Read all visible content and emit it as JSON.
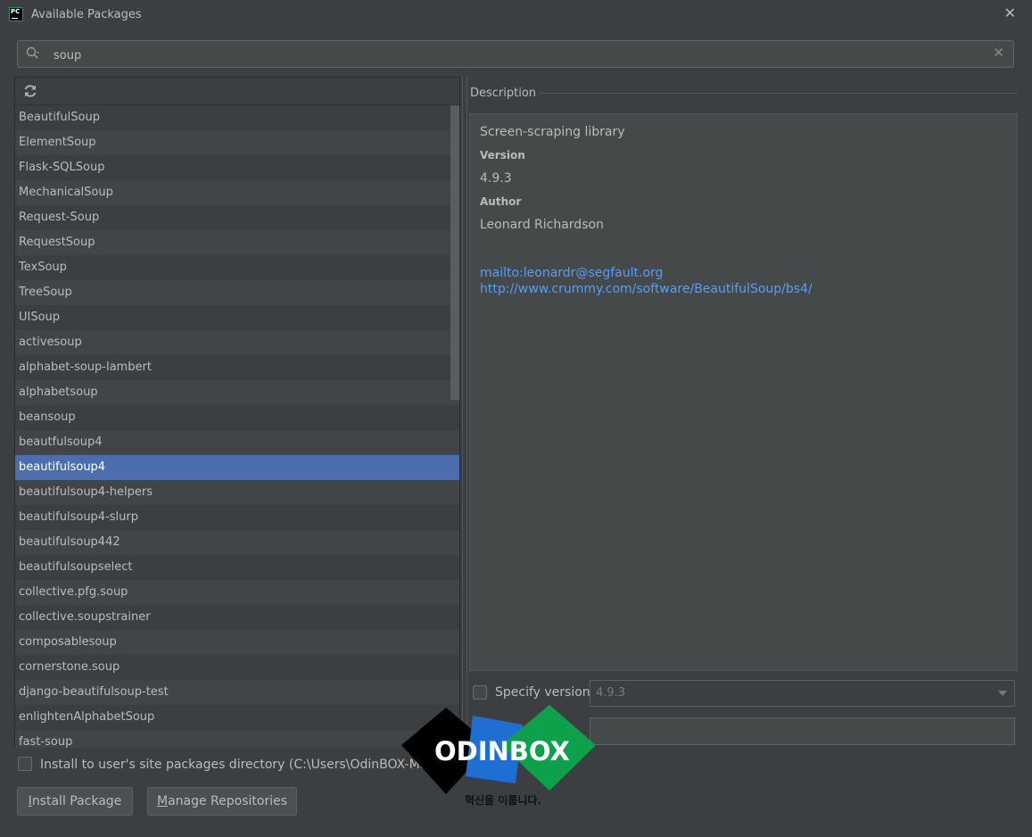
{
  "window": {
    "title": "Available Packages",
    "icon_text": "PC"
  },
  "search": {
    "value": "soup",
    "placeholder": ""
  },
  "packages": [
    "BeautifulSoup",
    "ElementSoup",
    "Flask-SQLSoup",
    "MechanicalSoup",
    "Request-Soup",
    "RequestSoup",
    "TexSoup",
    "TreeSoup",
    "UISoup",
    "activesoup",
    "alphabet-soup-lambert",
    "alphabetsoup",
    "beansoup",
    "beautfulsoup4",
    "beautifulsoup4",
    "beautifulsoup4-helpers",
    "beautifulsoup4-slurp",
    "beautifulsoup442",
    "beautifulsoupselect",
    "collective.pfg.soup",
    "collective.soupstrainer",
    "composablesoup",
    "cornerstone.soup",
    "django-beautifulsoup-test",
    "enlightenAlphabetSoup",
    "fast-soup"
  ],
  "selected_package": "beautifulsoup4",
  "description": {
    "label": "Description",
    "summary": "Screen-scraping library",
    "version_label": "Version",
    "version": "4.9.3",
    "author_label": "Author",
    "author": "Leonard Richardson",
    "email_link": "mailto:leonardr@segfault.org",
    "home_link": "http://www.crummy.com/software/BeautifulSoup/bs4/"
  },
  "options": {
    "specify_version_label": "Specify version",
    "specify_version_value": "4.9.3",
    "options_field_value": ""
  },
  "install_to_user": {
    "label": "Install to user's site packages directory (C:\\Users\\OdinBOX-Main\\AppData\\Roaming\\Python)"
  },
  "buttons": {
    "install_first": "I",
    "install_rest": "nstall Package",
    "manage_first": "M",
    "manage_rest": "anage Repositories"
  },
  "watermark": {
    "brand": "ODINBOX",
    "tagline": "혁신을 이룹니다."
  },
  "colors": {
    "background": "#3c3f41",
    "selection": "#4b6eaf",
    "link": "#589df6",
    "logo_black": "#000000",
    "logo_blue": "#1e6fd1",
    "logo_green": "#0ca14a"
  }
}
